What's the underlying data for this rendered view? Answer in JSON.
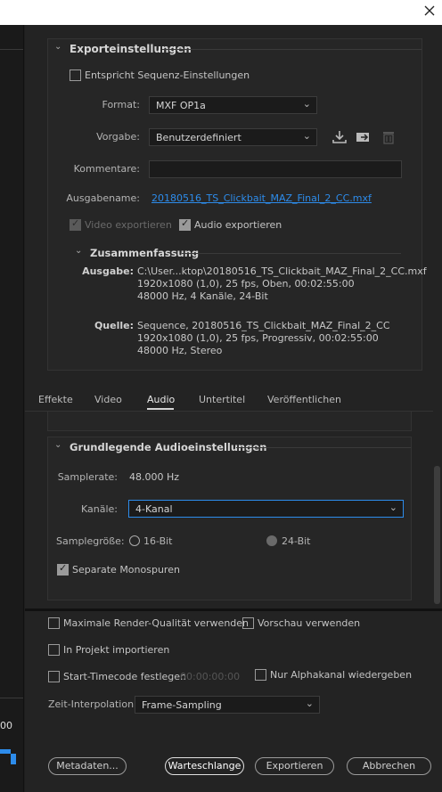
{
  "window": {
    "close_glyph": "✕"
  },
  "left_edge": {
    "value": "00"
  },
  "export_settings": {
    "title": "Exporteinstellungen",
    "match_sequence_label": "Entspricht Sequenz-Einstellungen",
    "format_label": "Format:",
    "format_value": "MXF OP1a",
    "preset_label": "Vorgabe:",
    "preset_value": "Benutzerdefiniert",
    "comments_label": "Kommentare:",
    "comments_value": "",
    "output_name_label": "Ausgabename:",
    "output_name_value": "20180516_TS_Clickbait_MAZ_Final_2_CC.mxf",
    "export_video_label": "Video exportieren",
    "export_audio_label": "Audio exportieren"
  },
  "summary": {
    "title": "Zusammenfassung",
    "output_key": "Ausgabe:",
    "output_lines": [
      "C:\\User...ktop\\20180516_TS_Clickbait_MAZ_Final_2_CC.mxf",
      "1920x1080 (1,0), 25 fps, Oben, 00:02:55:00",
      "48000 Hz, 4 Kanäle, 24-Bit"
    ],
    "source_key": "Quelle:",
    "source_lines": [
      "Sequence, 20180516_TS_Clickbait_MAZ_Final_2_CC",
      "1920x1080 (1,0), 25 fps, Progressiv, 00:02:55:00",
      "48000 Hz, Stereo"
    ]
  },
  "tabs": [
    {
      "label": "Effekte",
      "active": false
    },
    {
      "label": "Video",
      "active": false
    },
    {
      "label": "Audio",
      "active": true
    },
    {
      "label": "Untertitel",
      "active": false
    },
    {
      "label": "Veröffentlichen",
      "active": false
    }
  ],
  "audio_basic": {
    "title": "Grundlegende Audioeinstellungen",
    "sample_rate_label": "Samplerate:",
    "sample_rate_value": "48.000 Hz",
    "channels_label": "Kanäle:",
    "channels_value": "4-Kanal",
    "sample_size_label": "Samplegröße:",
    "sample_size_16": "16-Bit",
    "sample_size_24": "24-Bit",
    "separate_mono_label": "Separate Monospuren"
  },
  "bottom": {
    "max_render_quality": "Maximale Render-Qualität verwenden",
    "use_previews": "Vorschau verwenden",
    "import_into_project": "In Projekt importieren",
    "set_start_timecode": "Start-Timecode festlegen",
    "start_timecode_value": "00:00:00:00",
    "render_alpha_only": "Nur Alphakanal wiedergeben",
    "time_interpolation_label": "Zeit-Interpolation:",
    "time_interpolation_value": "Frame-Sampling"
  },
  "buttons": {
    "metadata": "Metadaten...",
    "queue": "Warteschlange",
    "export": "Exportieren",
    "cancel": "Abbrechen"
  },
  "colors": {
    "accent": "#2d8ceb",
    "background": "#232323",
    "panel": "#262626"
  }
}
